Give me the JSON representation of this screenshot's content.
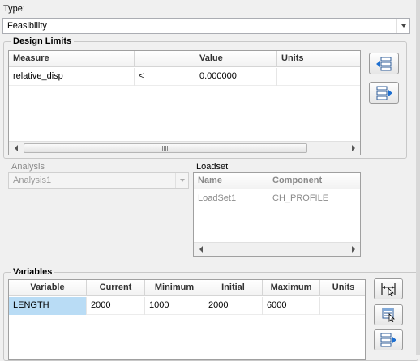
{
  "type": {
    "label": "Type:",
    "selected": "Feasibility"
  },
  "design_limits": {
    "title": "Design Limits",
    "columns": [
      "Measure",
      "",
      "Value",
      "Units"
    ],
    "rows": [
      {
        "measure": "relative_disp",
        "op": "<",
        "value": "0.000000",
        "units": ""
      }
    ],
    "buttons": [
      "add-limit",
      "remove-limit"
    ]
  },
  "analysis": {
    "label": "Analysis",
    "selected": "Analysis1"
  },
  "loadset": {
    "label": "Loadset",
    "columns": [
      "Name",
      "Component"
    ],
    "rows": [
      {
        "name": "LoadSet1",
        "component": "CH_PROFILE"
      }
    ]
  },
  "variables": {
    "title": "Variables",
    "columns": [
      "Variable",
      "Current",
      "Minimum",
      "Initial",
      "Maximum",
      "Units"
    ],
    "rows": [
      {
        "variable": "LENGTH",
        "current": "2000",
        "minimum": "1000",
        "initial": "2000",
        "maximum": "6000",
        "units": ""
      }
    ],
    "buttons": [
      "select-dimension",
      "select-parameter",
      "remove-variable"
    ]
  },
  "icons": [
    "chevron-down-icon",
    "scroll-left-icon",
    "scroll-right-icon"
  ]
}
